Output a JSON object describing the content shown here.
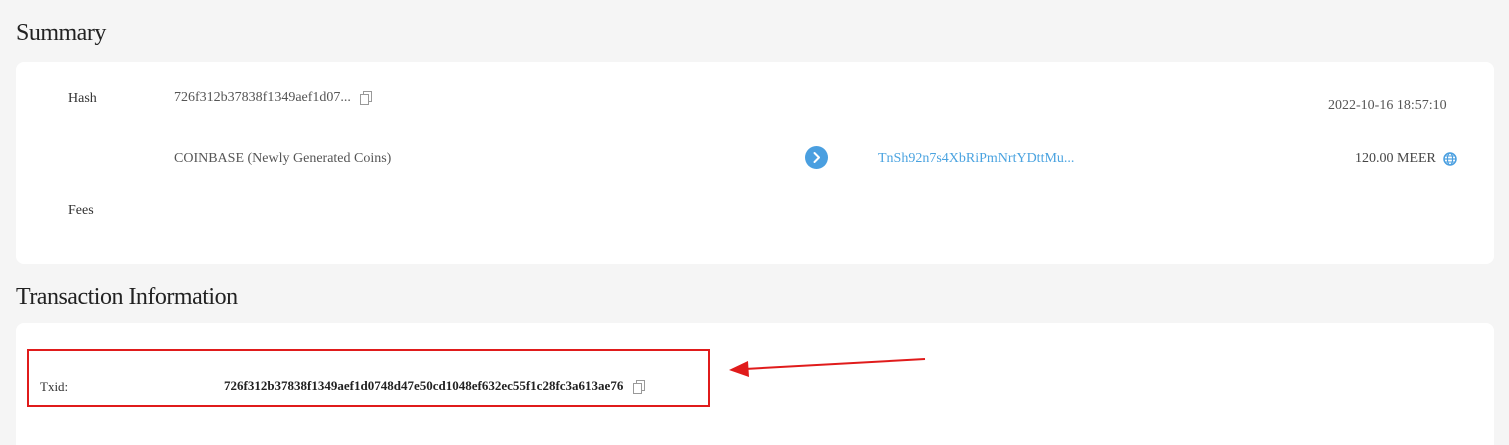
{
  "summary": {
    "title": "Summary",
    "hash_label": "Hash",
    "hash_value": "726f312b37838f1349aef1d07...",
    "timestamp": "2022-10-16 18:57:10",
    "input_label": "COINBASE (Newly Generated Coins)",
    "output_address": "TnSh92n7s4XbRiPmNrtYDttMu...",
    "output_amount": "120.00 MEER",
    "fees_label": "Fees"
  },
  "transaction_info": {
    "title": "Transaction Information",
    "txid_label": "Txid:",
    "txid_value": "726f312b37838f1349aef1d0748d47e50cd1048ef632ec55f1c28fc3a613ae76"
  },
  "colors": {
    "accent": "#4a9fe0",
    "link": "#4aa3e0",
    "annotation": "#e01b1b",
    "background": "#f5f5f5",
    "card": "#ffffff"
  },
  "icons": {
    "copy": "copy-icon",
    "arrow": "chevron-right-icon",
    "globe": "globe-icon"
  }
}
